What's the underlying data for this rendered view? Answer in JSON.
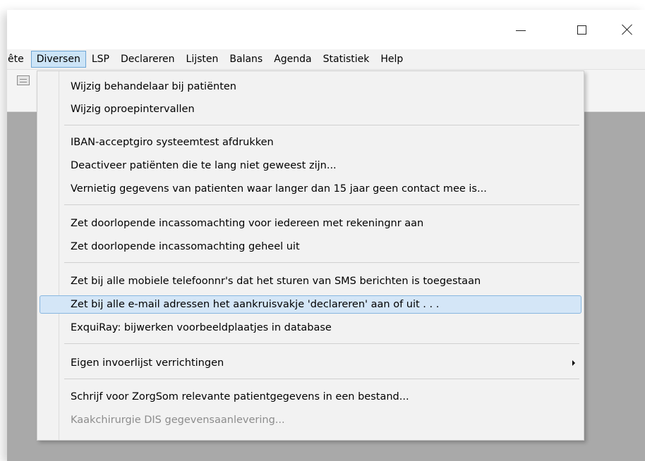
{
  "window": {
    "minimize_icon": "minimize-icon",
    "maximize_icon": "maximize-icon",
    "close_icon": "close-icon"
  },
  "menubar": {
    "items": [
      {
        "label": "ête"
      },
      {
        "label": "Diversen",
        "active": true
      },
      {
        "label": "LSP"
      },
      {
        "label": "Declareren"
      },
      {
        "label": "Lijsten"
      },
      {
        "label": "Balans"
      },
      {
        "label": "Agenda"
      },
      {
        "label": "Statistiek"
      },
      {
        "label": "Help"
      }
    ]
  },
  "toolbar": {
    "icon": "list-icon"
  },
  "menu": {
    "items": [
      {
        "label": "Wijzig behandelaar bij patiënten"
      },
      {
        "label": "Wijzig oproepintervallen"
      },
      {
        "label": "IBAN-acceptgiro systeemtest afdrukken"
      },
      {
        "label": "Deactiveer patiënten die te lang niet geweest zijn..."
      },
      {
        "label": "Vernietig gegevens van patienten waar langer dan 15 jaar geen contact mee is..."
      },
      {
        "label": "Zet doorlopende incassomachting voor iedereen met rekeningnr aan"
      },
      {
        "label": "Zet doorlopende incassomachting geheel uit"
      },
      {
        "label": "Zet bij alle mobiele telefoonnr's dat het sturen van SMS berichten is toegestaan"
      },
      {
        "label": "Zet bij alle e-mail adressen het aankruisvakje 'declareren' aan of uit . . ."
      },
      {
        "label": "ExquiRay: bijwerken voorbeeldplaatjes in database"
      },
      {
        "label": "Eigen invoerlijst verrichtingen"
      },
      {
        "label": "Schrijf voor ZorgSom relevante patientgegevens in een bestand..."
      },
      {
        "label": "Kaakchirurgie DIS gegevensaanlevering..."
      }
    ]
  },
  "colors": {
    "highlight": "#d4e6f7",
    "active_menu": "#cce4f7",
    "workspace": "#a9a9a9",
    "disabled_text": "#8c8c8c"
  }
}
